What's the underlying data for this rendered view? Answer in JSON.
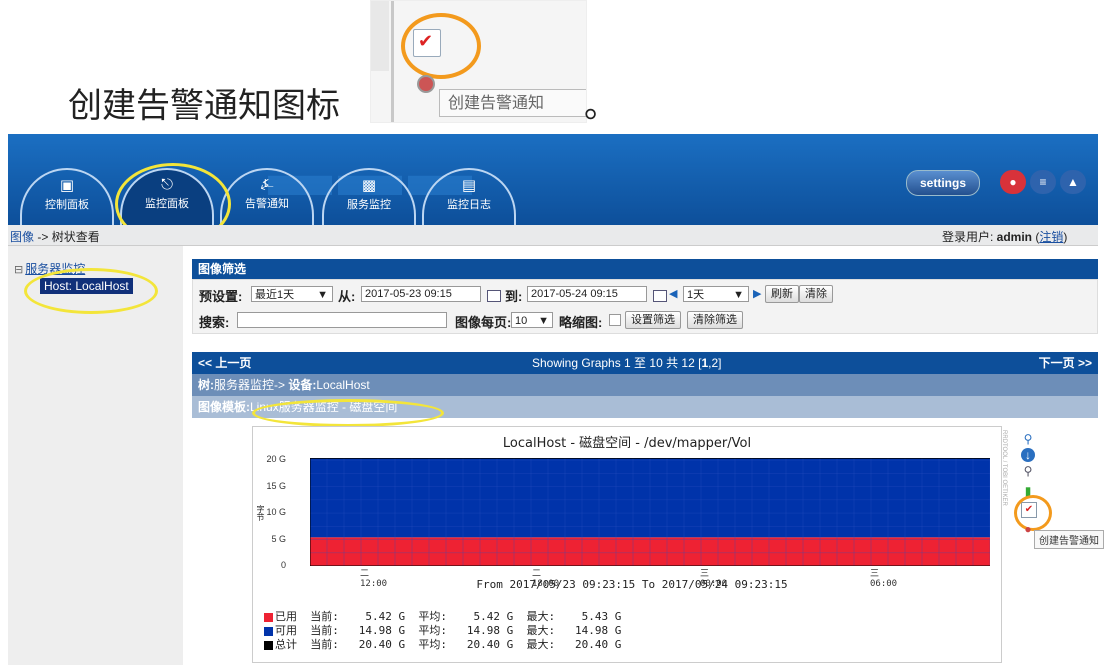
{
  "caption": {
    "text": "创建告警通知图标",
    "period": "。",
    "zoom_tooltip": "创建告警通知"
  },
  "header": {
    "tabs": [
      {
        "label": "控制面板",
        "icon": "dashboard-icon"
      },
      {
        "label": "监控面板",
        "icon": "graph-icon"
      },
      {
        "label": "告警通知",
        "icon": "bell-icon"
      },
      {
        "label": "服务监控",
        "icon": "camera-icon"
      },
      {
        "label": "监控日志",
        "icon": "log-icon"
      }
    ],
    "active_tab": "监控面板",
    "settings_label": "settings"
  },
  "breadcrumb": {
    "link": "图像",
    "rest": " -> 树状查看"
  },
  "login": {
    "prefix": "登录用户: ",
    "user": "admin",
    "logout": "注销"
  },
  "tree": {
    "root": "服务器监控",
    "host": "Host: LocalHost"
  },
  "filter": {
    "title": "图像筛选",
    "preset_label": "预设置:",
    "preset_value": "最近1天",
    "from_label": "从:",
    "from_value": "2017-05-23 09:15",
    "to_label": "到:",
    "to_value": "2017-05-24 09:15",
    "span_value": "1天",
    "refresh": "刷新",
    "clear": "清除",
    "search_label": "搜索:",
    "search_value": "",
    "per_page_label": "图像每页:",
    "per_page_value": "10",
    "thumb_label": "略缩图:",
    "set_filter": "设置筛选",
    "clear_filter": "清除筛选"
  },
  "paging": {
    "prev": "<< 上一页",
    "showing": "Showing Graphs 1 至 10 共 12 [",
    "page1": "1",
    "sep": ",",
    "page2": "2",
    "close": "]",
    "next": "下一页 >>"
  },
  "tree_row": {
    "prefix": "树:",
    "tree": "服务器监控",
    "arrow": "-> ",
    "device_label": "设备:",
    "device": "LocalHost"
  },
  "template_row": {
    "label": "图像模板:",
    "value": "Linux服务器监控 - 磁盘空间"
  },
  "graph_links": {
    "tooltip": "创建告警通知"
  },
  "chart_data": {
    "type": "area",
    "title": "LocalHost - 磁盘空间 - /dev/mapper/Vol",
    "ylabel": "字节",
    "y_ticks": [
      "0",
      "5 G",
      "10 G",
      "15 G",
      "20 G"
    ],
    "ylim": [
      0,
      20.4
    ],
    "x_ticks": [
      "二 12:00",
      "二 18:00",
      "三 00:00",
      "三 06:00"
    ],
    "subtitle": "From 2017/05/23 09:23:15 To 2017/05/24 09:23:15",
    "grid": true,
    "series": [
      {
        "name": "已用",
        "color": "#ee2233",
        "value": 5.42
      },
      {
        "name": "可用",
        "color": "#0033aa",
        "value": 14.98
      },
      {
        "name": "总计",
        "color": "#000000",
        "value": 20.4
      }
    ],
    "legend": [
      {
        "name": "已用",
        "color": "#ee2233",
        "current": "5.42 G",
        "avg": "5.42 G",
        "max": "5.43 G"
      },
      {
        "name": "可用",
        "color": "#0033aa",
        "current": "14.98 G",
        "avg": "14.98 G",
        "max": "14.98 G"
      },
      {
        "name": "总计",
        "color": "#000000",
        "current": "20.40 G",
        "avg": "20.40 G",
        "max": "20.40 G"
      }
    ],
    "legend_cur": "当前:",
    "legend_avg": "平均:",
    "legend_max": "最大:"
  }
}
